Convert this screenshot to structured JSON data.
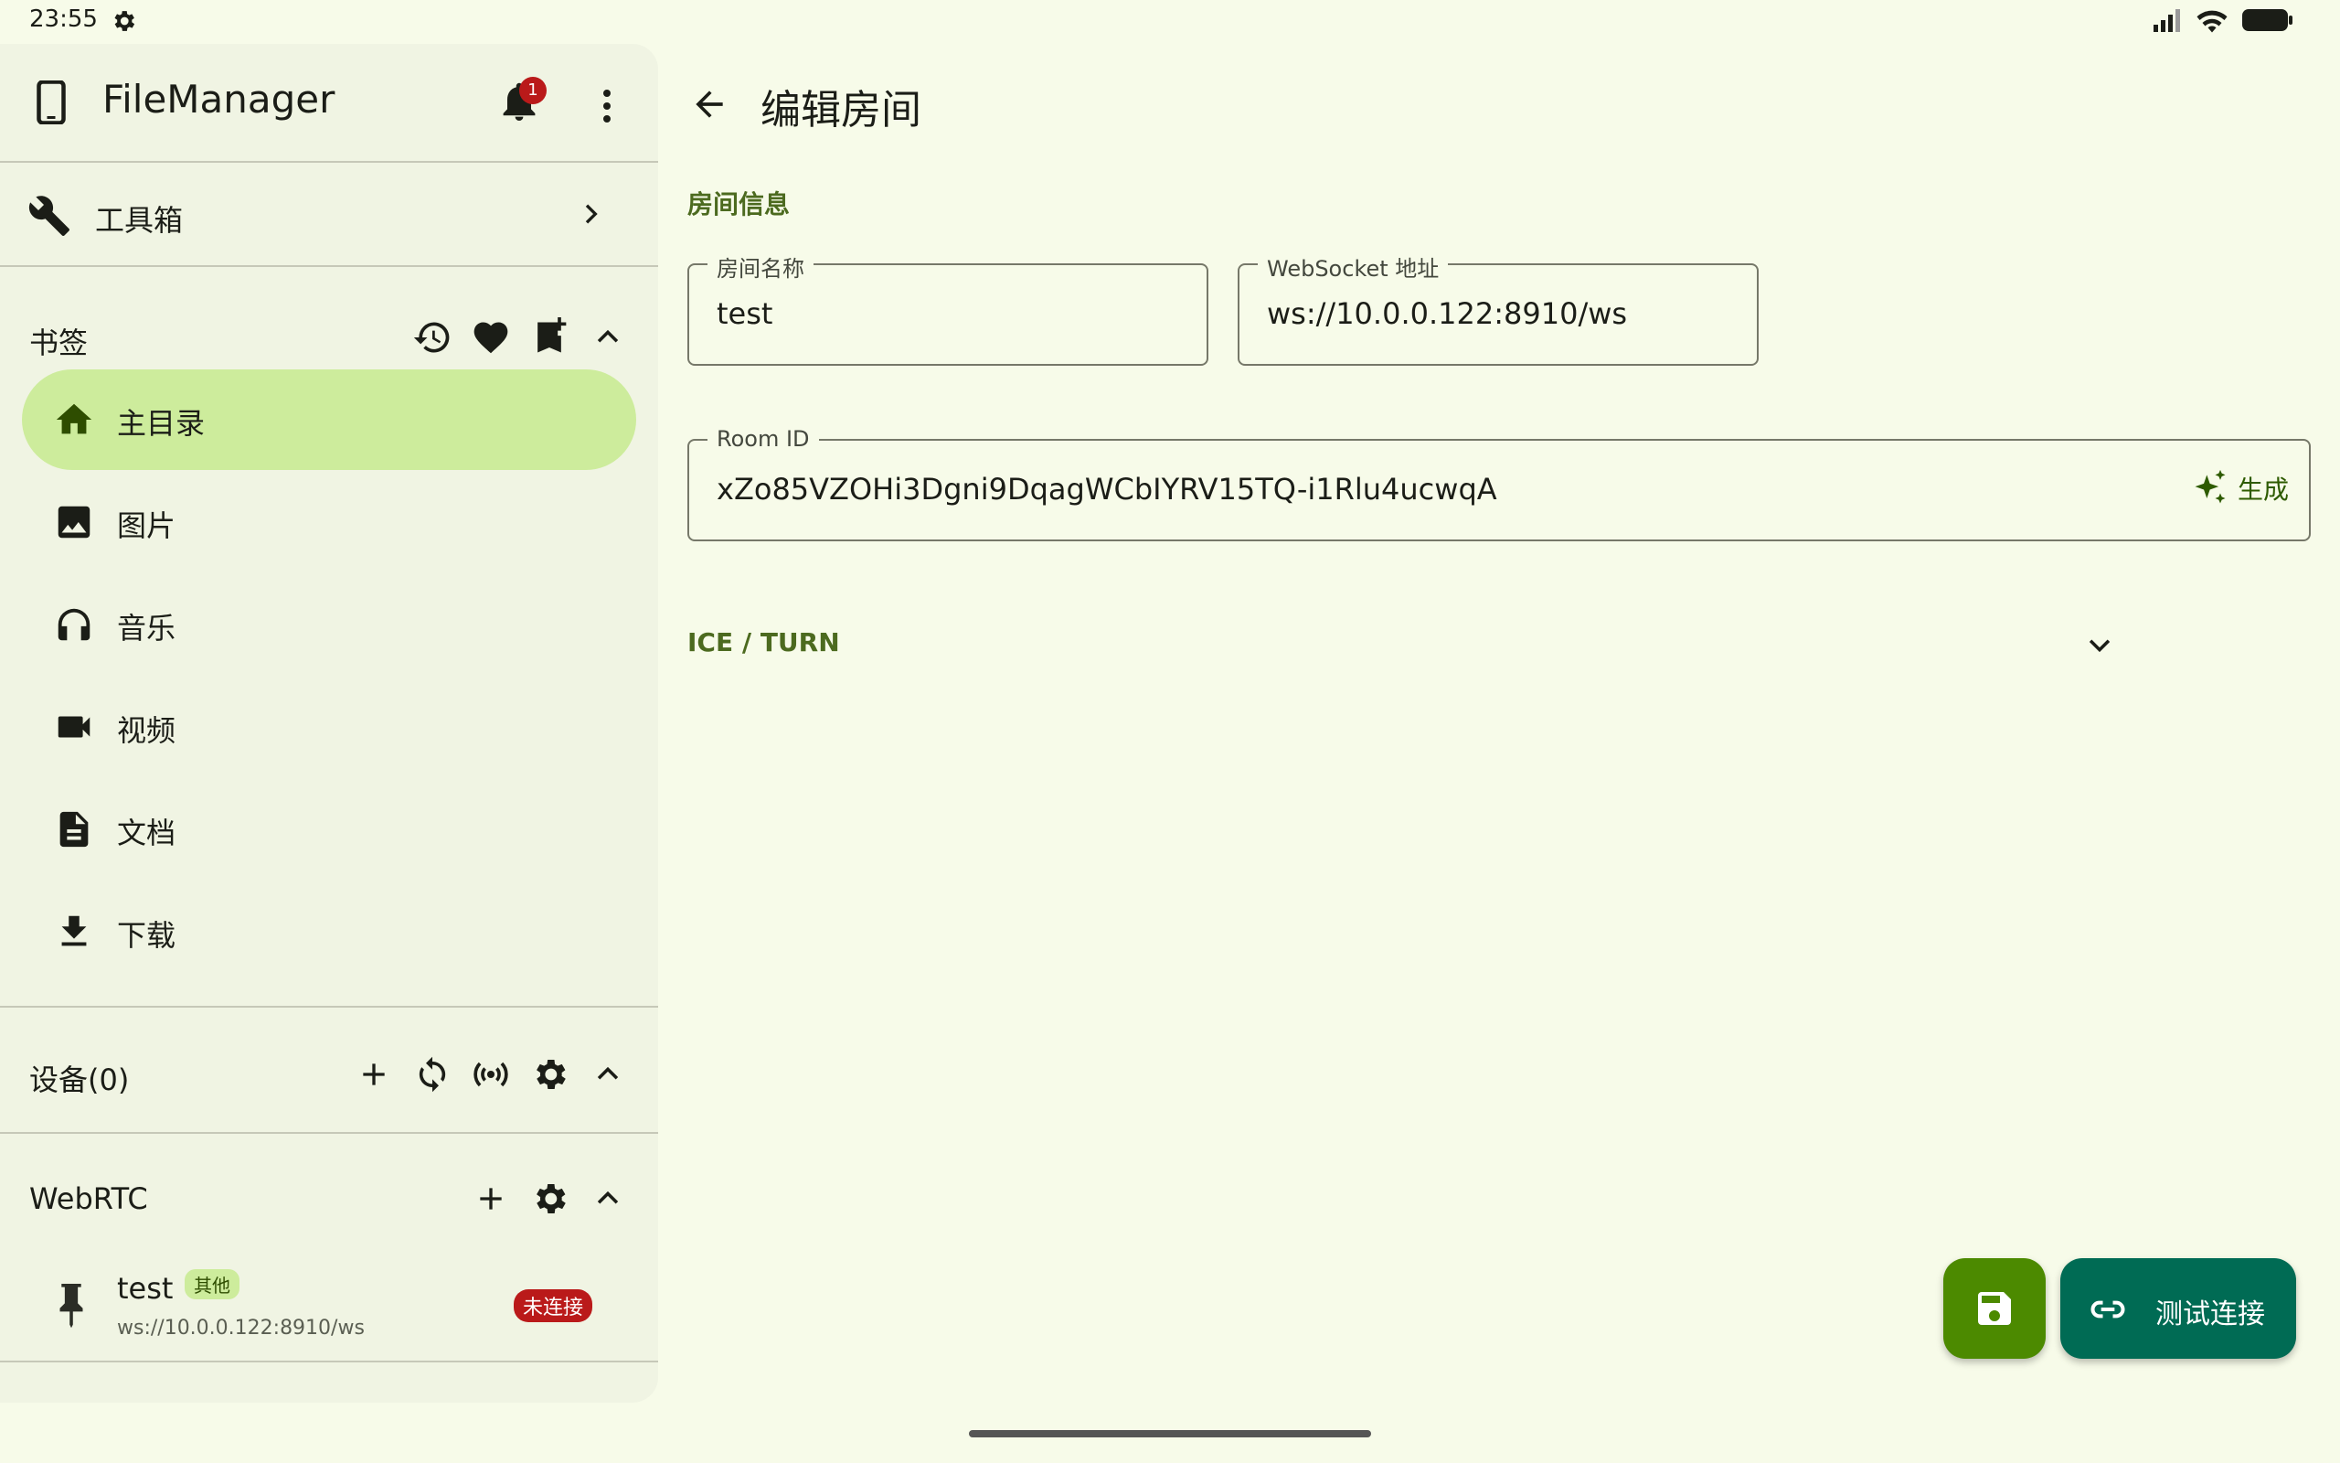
{
  "status_bar": {
    "time": "23:55"
  },
  "drawer": {
    "app_title": "FileManager",
    "notification_count": "1",
    "toolbox_label": "工具箱",
    "bookmarks": {
      "title": "书签",
      "items": [
        {
          "label": "主目录",
          "icon": "home-icon",
          "active": true
        },
        {
          "label": "图片",
          "icon": "image-icon",
          "active": false
        },
        {
          "label": "音乐",
          "icon": "headphones-icon",
          "active": false
        },
        {
          "label": "视频",
          "icon": "video-icon",
          "active": false
        },
        {
          "label": "文档",
          "icon": "document-icon",
          "active": false
        },
        {
          "label": "下载",
          "icon": "download-icon",
          "active": false
        }
      ]
    },
    "devices": {
      "title": "设备(0)"
    },
    "webrtc": {
      "title": "WebRTC",
      "rooms": [
        {
          "name": "test",
          "tag": "其他",
          "url": "ws://10.0.0.122:8910/ws",
          "status": "未连接"
        }
      ]
    }
  },
  "main": {
    "title": "编辑房间",
    "section_label": "房间信息",
    "room_name": {
      "label": "房间名称",
      "value": "test"
    },
    "websocket": {
      "label": "WebSocket 地址",
      "value": "ws://10.0.0.122:8910/ws"
    },
    "room_id": {
      "label": "Room ID",
      "value": "xZo85VZOHi3Dgni9DqagWCbIYRV15TQ-i1Rlu4ucwqA",
      "generate_label": "生成"
    },
    "ice_label": "ICE / TURN",
    "test_button_label": "测试连接"
  },
  "colors": {
    "background": "#f7fbe9",
    "drawer": "#f0f4e3",
    "active_item": "#cdec9c",
    "accent": "#4c6a1f",
    "save_fab": "#4c8a00",
    "test_fab": "#006b54",
    "error": "#ba1a1a"
  }
}
